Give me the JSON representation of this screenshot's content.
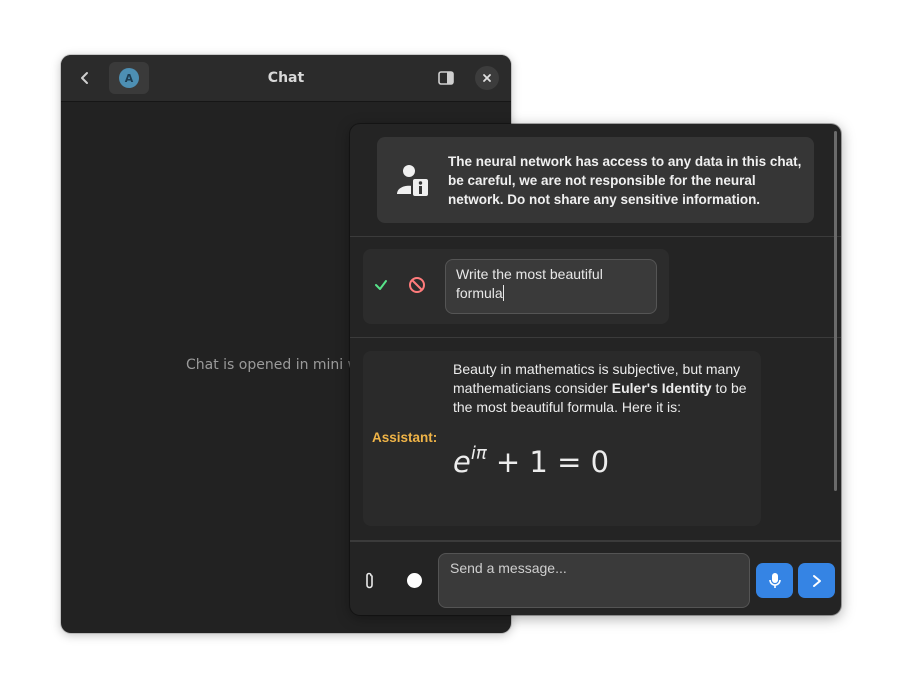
{
  "main_window": {
    "title": "Chat",
    "avatar_letter": "A",
    "mini_window_note": "Chat is opened in mini wi"
  },
  "mini_window": {
    "warning": "The neural network has access to any data in this chat, be careful, we are not responsible for the neural network. Do not share any sensitive information.",
    "edit_message": "Write the most beautiful formula",
    "assistant": {
      "label": "Assistant:",
      "text_before": "Beauty in mathematics is subjective, but many mathematicians consider ",
      "text_bold": "Euler's Identity",
      "text_after": " to be the most beautiful formula. Here it is:",
      "formula_base": "e",
      "formula_exponent": "iπ",
      "formula_rest": "+ 1 = 0"
    },
    "input_placeholder": "Send a message..."
  },
  "colors": {
    "accent": "#3584e4",
    "assistant_label": "#f0b447",
    "confirm": "#57e389",
    "cancel": "#ff7b7b"
  },
  "icons": [
    "back-icon",
    "avatar",
    "sidebar-toggle-icon",
    "close-icon",
    "user-info-icon",
    "checkmark-icon",
    "cancel-icon",
    "paperclip-icon",
    "record-icon",
    "microphone-icon",
    "send-arrow-icon"
  ]
}
